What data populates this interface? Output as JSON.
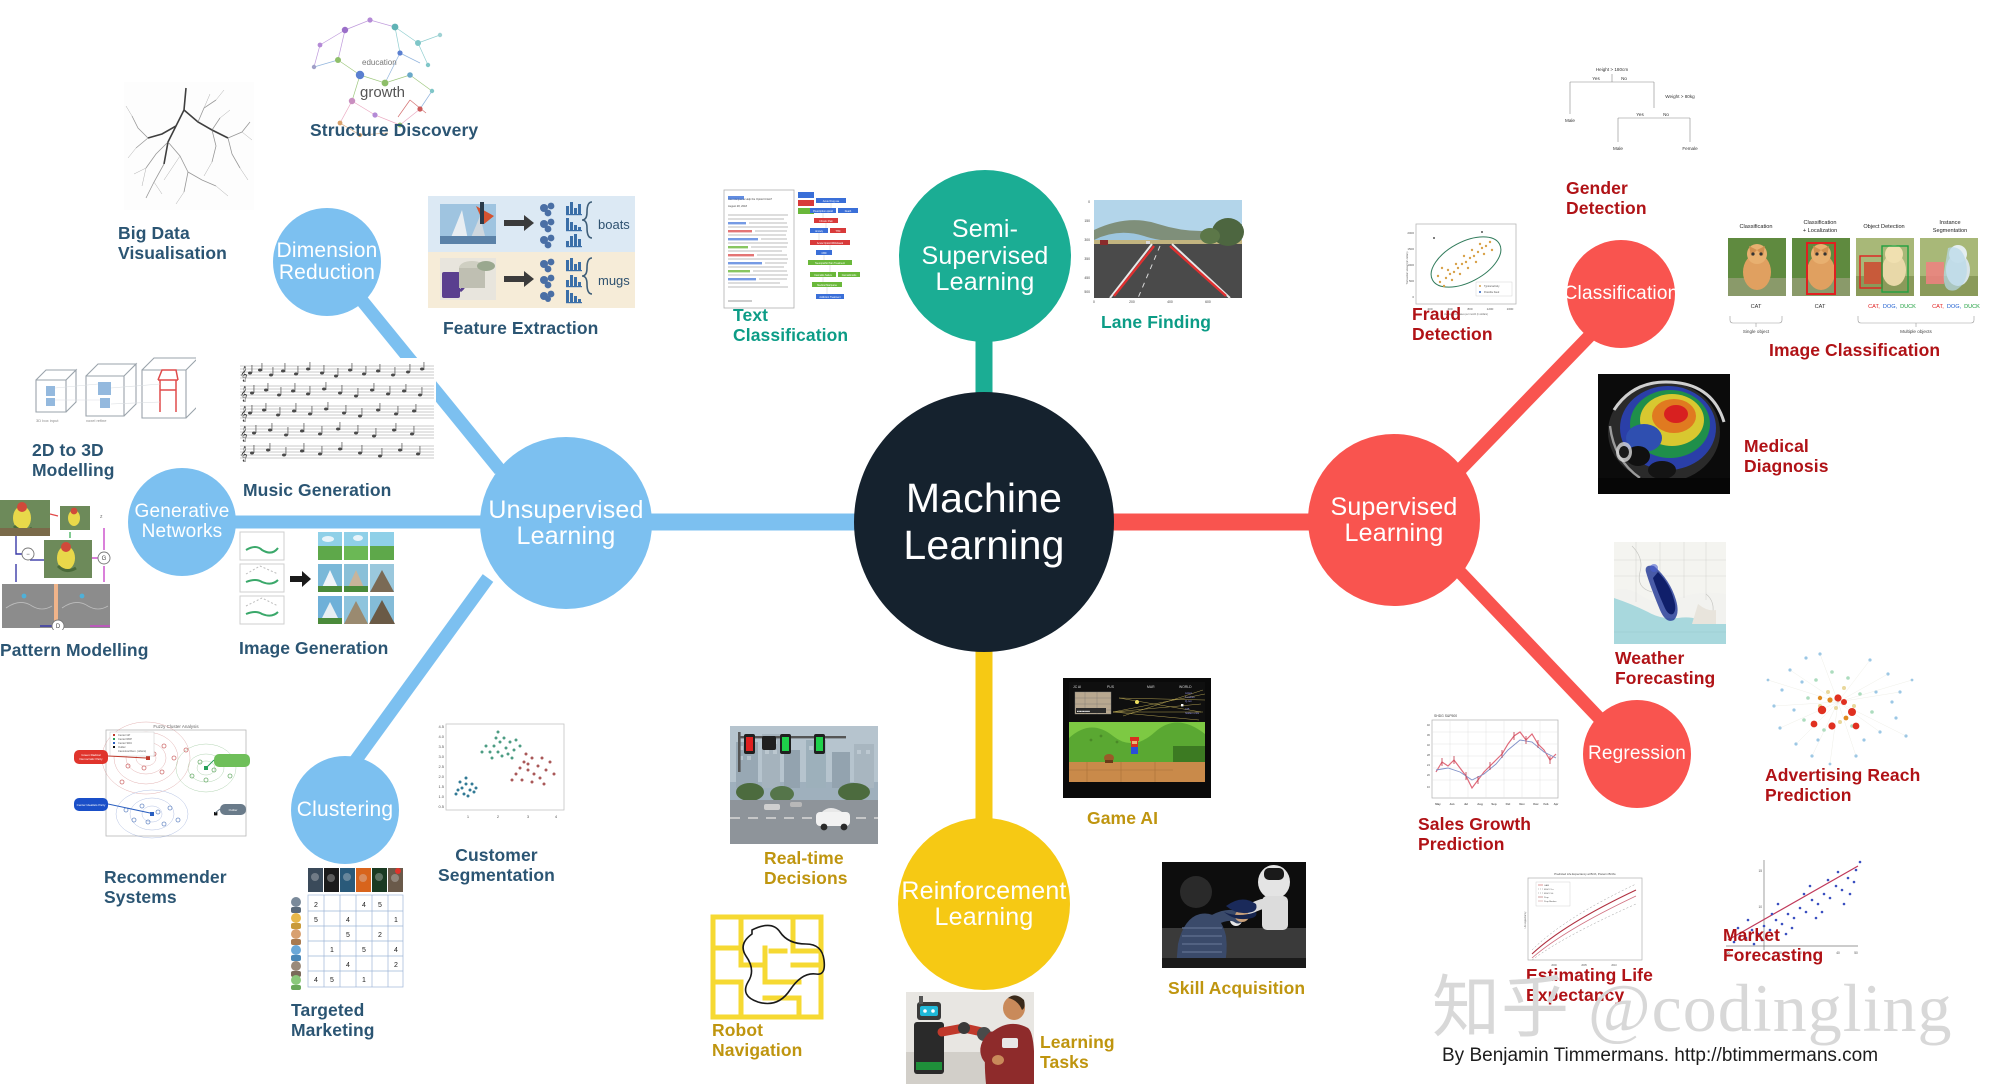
{
  "center": {
    "line1": "Machine",
    "line2": "Learning"
  },
  "branches": [
    {
      "id": "semi-supervised",
      "label": "Semi-\nSupervised\nLearning",
      "color": "#1BAD94"
    },
    {
      "id": "unsupervised",
      "label": "Unsupervised\nLearning",
      "color": "#7CC0F0"
    },
    {
      "id": "supervised",
      "label": "Supervised\nLearning",
      "color": "#F9544F"
    },
    {
      "id": "reinforcement",
      "label": "Reinforcement\nLearning",
      "color": "#F6C914"
    }
  ],
  "sub_nodes": [
    {
      "id": "dimension-reduction",
      "label": "Dimension\nReduction",
      "parent": "unsupervised",
      "color": "#7CC0F0"
    },
    {
      "id": "generative-networks",
      "label": "Generative\nNetworks",
      "parent": "unsupervised",
      "color": "#7CC0F0"
    },
    {
      "id": "clustering",
      "label": "Clustering",
      "parent": "unsupervised",
      "color": "#7CC0F0"
    },
    {
      "id": "classification",
      "label": "Classification",
      "parent": "supervised",
      "color": "#F9544F"
    },
    {
      "id": "regression",
      "label": "Regression",
      "parent": "supervised",
      "color": "#F9544F"
    }
  ],
  "applications": {
    "unsupervised": [
      {
        "id": "structure-discovery",
        "label": "Structure Discovery"
      },
      {
        "id": "big-data-visualisation",
        "label": "Big Data\nVisualisation"
      },
      {
        "id": "feature-extraction",
        "label": "Feature Extraction"
      },
      {
        "id": "2d-to-3d-modelling",
        "label": "2D to 3D\nModelling"
      },
      {
        "id": "music-generation",
        "label": "Music Generation"
      },
      {
        "id": "pattern-modelling",
        "label": "Pattern Modelling"
      },
      {
        "id": "image-generation",
        "label": "Image Generation"
      },
      {
        "id": "recommender-systems",
        "label": "Recommender\nSystems"
      },
      {
        "id": "targeted-marketing",
        "label": "Targeted\nMarketing"
      },
      {
        "id": "customer-segmentation",
        "label": "Customer\nSegmentation"
      }
    ],
    "semi_supervised": [
      {
        "id": "text-classification",
        "label": "Text\nClassification"
      },
      {
        "id": "lane-finding",
        "label": "Lane Finding"
      }
    ],
    "supervised": [
      {
        "id": "fraud-detection",
        "label": "Fraud\nDetection"
      },
      {
        "id": "gender-detection",
        "label": "Gender\nDetection"
      },
      {
        "id": "image-classification",
        "label": "Image Classification"
      },
      {
        "id": "medical-diagnosis",
        "label": "Medical\nDiagnosis"
      },
      {
        "id": "weather-forecasting",
        "label": "Weather\nForecasting"
      },
      {
        "id": "advertising-reach-prediction",
        "label": "Advertising Reach\nPrediction"
      },
      {
        "id": "sales-growth-prediction",
        "label": "Sales Growth\nPrediction"
      },
      {
        "id": "estimating-life-expectancy",
        "label": "Estimating Life\nExpectancy"
      },
      {
        "id": "market-forecasting",
        "label": "Market\nForecasting"
      }
    ],
    "reinforcement": [
      {
        "id": "real-time-decisions",
        "label": "Real-time\nDecisions"
      },
      {
        "id": "game-ai",
        "label": "Game AI"
      },
      {
        "id": "robot-navigation",
        "label": "Robot\nNavigation"
      },
      {
        "id": "learning-tasks",
        "label": "Learning\nTasks"
      },
      {
        "id": "skill-acquisition",
        "label": "Skill Acquisition"
      }
    ]
  },
  "thumbnail_text": {
    "structure_discovery_word": "growth",
    "feature_extraction": {
      "row1": "boats",
      "row2": "mugs"
    },
    "gender_tree": {
      "root": "Height > 180cm",
      "yes": "Yes",
      "no": "No",
      "second": "Weight > 80kg",
      "leaf_male_left": "Male",
      "leaf_male": "Male",
      "leaf_female": "Female"
    },
    "image_classification": {
      "headers": [
        "Classification",
        "Classification\n+ Localization",
        "Object Detection",
        "Instance\nSegmentation"
      ],
      "labels": [
        "CAT",
        "CAT",
        "CAT, DOG, DUCK",
        "CAT, DOG, DUCK"
      ],
      "footers": [
        "Single object",
        "Multiple objects"
      ]
    }
  },
  "watermark": "知乎 @codingling",
  "credit": "By Benjamin Timmermans. http://btimmermans.com",
  "colors": {
    "center": "#15222e",
    "teal": "#1BAD94",
    "blue": "#7CC0F0",
    "red": "#F9544F",
    "yellow": "#F6C914",
    "caption_blue": "#2B5573",
    "caption_teal": "#0C9C86",
    "caption_red": "#B01216",
    "caption_yellow": "#BF950F"
  }
}
